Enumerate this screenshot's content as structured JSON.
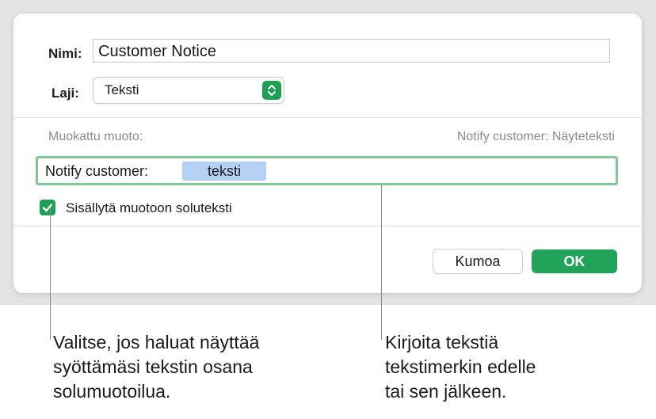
{
  "dialog": {
    "name_label": "Nimi:",
    "name_value": "Customer Notice",
    "type_label": "Laji:",
    "type_value": "Teksti",
    "custom_format_label": "Muokattu muoto:",
    "preview_text": "Notify customer: Näyteteksti",
    "format_prefix": "Notify customer:",
    "format_token": "teksti",
    "include_checkbox_label": "Sisällytä muotoon soluteksti",
    "include_checked": true,
    "cancel_label": "Kumoa",
    "ok_label": "OK"
  },
  "callouts": {
    "left": "Valitse, jos haluat näyttää\nsyöttämäsi tekstin osana\nsolumuotoilua.",
    "right": "Kirjoita tekstiä\ntekstimerkin edelle\ntai sen jälkeen."
  },
  "colors": {
    "accent_green": "#21a35a",
    "token_blue": "#b3d2f3",
    "focus_ring": "#82c795"
  },
  "icons": {
    "type_stepper": "chevron-up-down-icon",
    "checkbox": "checkmark-icon"
  }
}
